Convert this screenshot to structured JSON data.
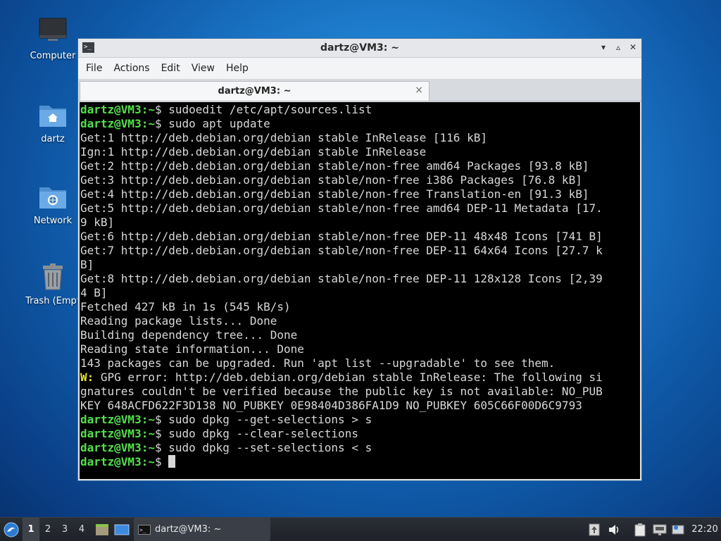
{
  "desktop": {
    "icons": [
      {
        "label": "Computer"
      },
      {
        "label": "dartz"
      },
      {
        "label": "Network"
      },
      {
        "label": "Trash (Empt"
      }
    ]
  },
  "window": {
    "title": "dartz@VM3: ~",
    "menu": [
      "File",
      "Actions",
      "Edit",
      "View",
      "Help"
    ],
    "tab_label": "dartz@VM3: ~",
    "tab_close": "×",
    "controls": {
      "minimize": "▾",
      "maximize": "▵",
      "close": "✕"
    }
  },
  "terminal": {
    "prompt": "dartz@VM3:~",
    "lines": [
      {
        "type": "cmd",
        "text": "$ sudoedit /etc/apt/sources.list"
      },
      {
        "type": "cmd",
        "text": "$ sudo apt update"
      },
      {
        "type": "out",
        "text": "Get:1 http://deb.debian.org/debian stable InRelease [116 kB]"
      },
      {
        "type": "out",
        "text": "Ign:1 http://deb.debian.org/debian stable InRelease"
      },
      {
        "type": "out",
        "text": "Get:2 http://deb.debian.org/debian stable/non-free amd64 Packages [93.8 kB]"
      },
      {
        "type": "out",
        "text": "Get:3 http://deb.debian.org/debian stable/non-free i386 Packages [76.8 kB]"
      },
      {
        "type": "out",
        "text": "Get:4 http://deb.debian.org/debian stable/non-free Translation-en [91.3 kB]"
      },
      {
        "type": "out",
        "text": "Get:5 http://deb.debian.org/debian stable/non-free amd64 DEP-11 Metadata [17."
      },
      {
        "type": "out",
        "text": "9 kB]"
      },
      {
        "type": "out",
        "text": "Get:6 http://deb.debian.org/debian stable/non-free DEP-11 48x48 Icons [741 B]"
      },
      {
        "type": "out",
        "text": "Get:7 http://deb.debian.org/debian stable/non-free DEP-11 64x64 Icons [27.7 k"
      },
      {
        "type": "out",
        "text": "B]"
      },
      {
        "type": "out",
        "text": "Get:8 http://deb.debian.org/debian stable/non-free DEP-11 128x128 Icons [2,39"
      },
      {
        "type": "out",
        "text": "4 B]"
      },
      {
        "type": "out",
        "text": "Fetched 427 kB in 1s (545 kB/s)"
      },
      {
        "type": "out",
        "text": "Reading package lists... Done"
      },
      {
        "type": "out",
        "text": "Building dependency tree... Done"
      },
      {
        "type": "out",
        "text": "Reading state information... Done"
      },
      {
        "type": "out",
        "text": "143 packages can be upgraded. Run 'apt list --upgradable' to see them."
      },
      {
        "type": "warn",
        "prefix": "W:",
        "text": " GPG error: http://deb.debian.org/debian stable InRelease: The following si"
      },
      {
        "type": "out",
        "text": "gnatures couldn't be verified because the public key is not available: NO_PUB"
      },
      {
        "type": "out",
        "text": "KEY 648ACFD622F3D138 NO_PUBKEY 0E98404D386FA1D9 NO_PUBKEY 605C66F00D6C9793"
      },
      {
        "type": "cmd",
        "text": "$ sudo dpkg --get-selections > s"
      },
      {
        "type": "cmd",
        "text": "$ sudo dpkg --clear-selections"
      },
      {
        "type": "cmd",
        "text": "$ sudo dpkg --set-selections < s"
      },
      {
        "type": "cursor",
        "text": "$ "
      }
    ]
  },
  "taskbar": {
    "workspaces": [
      "1",
      "2",
      "3",
      "4"
    ],
    "active_workspace": "1",
    "task_label": "dartz@VM3: ~",
    "clock": "22:20"
  }
}
